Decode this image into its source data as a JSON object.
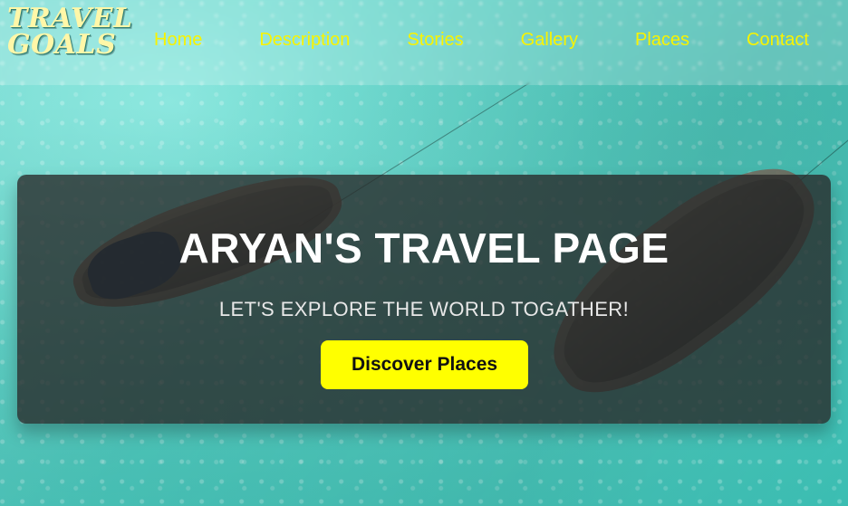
{
  "brand": {
    "logo_line1": "TRAVEL",
    "logo_line2": "GOALS",
    "logo_color": "#fff7a8",
    "nav_text_color": "#f8f300"
  },
  "nav": {
    "items": [
      {
        "label": "Home"
      },
      {
        "label": "Description"
      },
      {
        "label": "Stories"
      },
      {
        "label": "Gallery"
      },
      {
        "label": "Places"
      },
      {
        "label": "Contact"
      }
    ]
  },
  "hero": {
    "title": "ARYAN'S TRAVEL PAGE",
    "subtitle": "LET'S EXPLORE THE WORLD TOGATHER!",
    "cta_label": "Discover Places",
    "cta_color": "#ffff00"
  },
  "background": {
    "image_description": ""
  }
}
